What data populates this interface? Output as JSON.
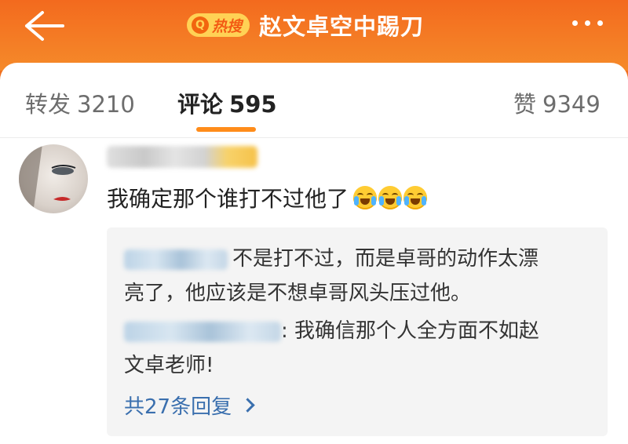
{
  "header": {
    "badge_text": "热搜",
    "badge_icon": "Q",
    "title": "赵文卓空中踢刀"
  },
  "tabs": [
    {
      "label": "转发",
      "count": "3210"
    },
    {
      "label": "评论",
      "count": "595"
    },
    {
      "label": "赞",
      "count": "9349"
    }
  ],
  "comment": {
    "text": "我确定那个谁打不过他了",
    "emojis": [
      "laugh-cry-emoji",
      "laugh-cry-emoji",
      "laugh-cry-emoji"
    ]
  },
  "replies": [
    {
      "line1": "不是打不过，而是卓哥的动作太漂",
      "line2": "亮了，他应该是不想卓哥风头压过他。"
    },
    {
      "line1": ": 我确信那个人全方面不如赵",
      "line2": "文卓老师!"
    }
  ],
  "more_replies": "共27条回复",
  "colors": {
    "accent": "#f36a1e",
    "tab_indicator": "#ff8c1a",
    "link": "#3a6fae"
  }
}
